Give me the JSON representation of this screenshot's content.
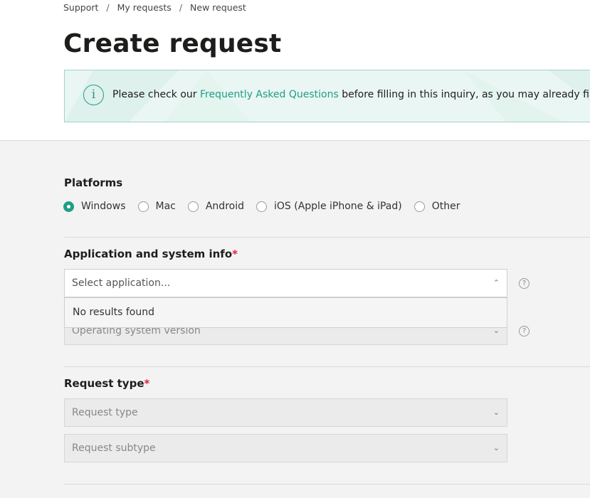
{
  "breadcrumb": {
    "items": [
      "Support",
      "My requests",
      "New request"
    ],
    "separator": "/"
  },
  "page_title": "Create request",
  "notice": {
    "text_before": "Please check our ",
    "link_text": "Frequently Asked Questions",
    "text_after": " before filling in this inquiry, as you may already find your answ",
    "icon": "info-icon"
  },
  "platforms": {
    "label": "Platforms",
    "options": [
      "Windows",
      "Mac",
      "Android",
      "iOS (Apple iPhone & iPad)",
      "Other"
    ],
    "selected": "Windows"
  },
  "app_info": {
    "label": "Application and system info",
    "required_mark": "*",
    "application_placeholder": "Select application...",
    "dropdown_empty": "No results found",
    "os_placeholder": "Operating system version",
    "help": "?"
  },
  "request_type": {
    "label": "Request type",
    "required_mark": "*",
    "type_placeholder": "Request type",
    "subtype_placeholder": "Request subtype"
  },
  "colors": {
    "accent": "#1f9e84",
    "required": "#e01f3d",
    "notice_bg": "#eaf6f3"
  }
}
